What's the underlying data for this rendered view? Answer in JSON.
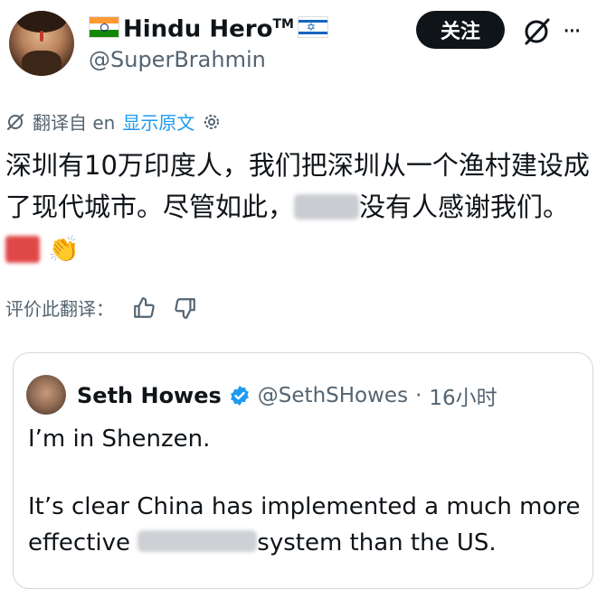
{
  "author": {
    "display_name": "Hindu Hero",
    "trademark": "TM",
    "handle": "@SuperBrahmin",
    "flag_left_colors": [
      "#ff9933",
      "#ffffff",
      "#138808"
    ],
    "flag_right_colors": [
      "#ffffff",
      "#1565c0"
    ]
  },
  "actions": {
    "follow_label": "关注",
    "more_label": "···"
  },
  "translation": {
    "translated_from": "翻译自 en",
    "show_original": "显示原文"
  },
  "tweet": {
    "text_part1": "深圳有10万印度人，我们把深圳从一个渔村建设成了现代城市。尽管如此，",
    "text_part2": "没有人感谢我们。",
    "emoji": "👏"
  },
  "rating": {
    "label": "评价此翻译："
  },
  "quoted_tweet": {
    "name": "Seth Howes",
    "handle": "@SethSHowes",
    "separator": "·",
    "time": "16小时",
    "line1": "I’m in Shenzen.",
    "line2_part1": "It’s clear China has implemented a much more effective",
    "line2_part2": "system than the US."
  },
  "colors": {
    "text": "#0f1419",
    "muted": "#536471",
    "link": "#1d9bf0",
    "verified": "#1d9bf0"
  }
}
